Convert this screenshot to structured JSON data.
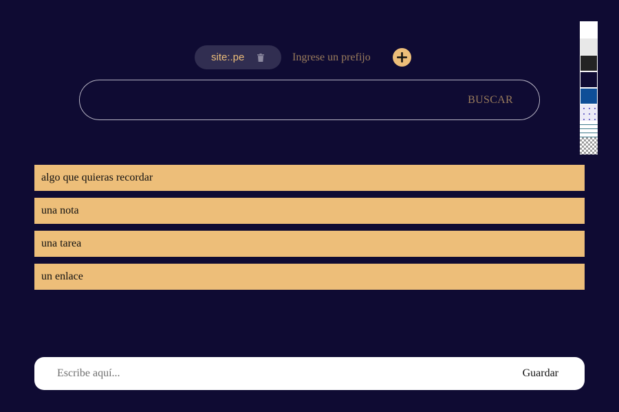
{
  "prefix": {
    "chip_label": "site:.pe",
    "input_value": "",
    "input_placeholder": "Ingrese un prefijo",
    "add_icon": "plus-circle-icon",
    "delete_icon": "trash-icon"
  },
  "search": {
    "input_value": "",
    "button_label": "BUSCAR"
  },
  "theme_palette": {
    "swatches": [
      {
        "name": "white",
        "color": "#ffffff"
      },
      {
        "name": "light-gray",
        "color": "#e8e8e8"
      },
      {
        "name": "dark",
        "color": "#232323"
      },
      {
        "name": "navy",
        "color": "#0f0b33"
      },
      {
        "name": "blue",
        "color": "#0e4e97"
      },
      {
        "name": "dots",
        "color": "#ecebf7"
      },
      {
        "name": "lines",
        "color": "#ffffff"
      },
      {
        "name": "checker",
        "color": "#9b9b9b"
      }
    ]
  },
  "notes": [
    {
      "text": "algo que quieras recordar"
    },
    {
      "text": "una nota"
    },
    {
      "text": "una tarea"
    },
    {
      "text": "un enlace"
    }
  ],
  "composer": {
    "input_value": "",
    "input_placeholder": "Escribe aquí...",
    "save_label": "Guardar"
  },
  "colors": {
    "background": "#0f0b33",
    "accent": "#edbe79",
    "chip_background": "#312e51",
    "muted_text": "#9a7c5c"
  }
}
